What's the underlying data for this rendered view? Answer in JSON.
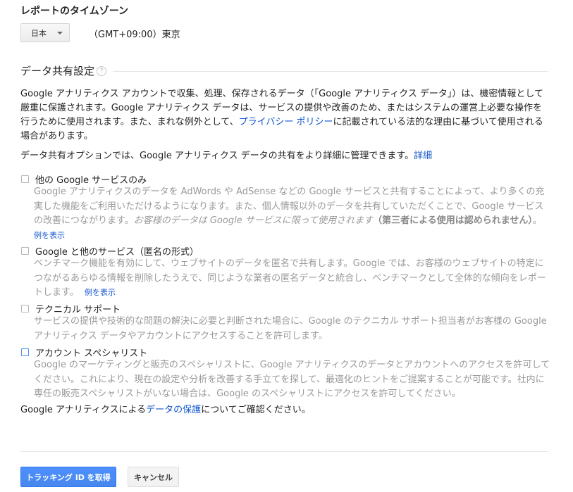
{
  "timezone": {
    "title": "レポートのタイムゾーン",
    "country": "日本",
    "value": "（GMT+09:00）東京"
  },
  "data_sharing": {
    "title": "データ共有設定",
    "help": "?",
    "intro": {
      "part1": "Google アナリティクス アカウントで収集、処理、保存されるデータ（「Google アナリティクス データ」）は、機密情報として厳重に保護されます。Google アナリティクス データは、サービスの提供や改善のため、またはシステムの運営上必要な操作を行うために使用されます。また、まれな例外として、",
      "link": "プライバシー ポリシー",
      "part2": "に記載されている法的な理由に基づいて使用される場合があります。"
    },
    "options_intro": {
      "text": "データ共有オプションでは、Google アナリティクス データの共有をより詳細に管理できます。",
      "link": "詳細"
    },
    "options": [
      {
        "title": "他の Google サービスのみ",
        "desc": "Google アナリティクスのデータを AdWords や AdSense などの Google サービスと共有することによって、より多くの充実した機能をご利用いただけるようになります。また、個人情報以外のデータを共有していただくことで、Google サービスの改善につながります。",
        "desc_italic": "お客様のデータは Google サービスに限って使用されます",
        "desc_bold": "（第三者による使用は認められません）",
        "desc_end": "。",
        "example_link": "例を表示"
      },
      {
        "title": "Google と他のサービス（匿名の形式）",
        "desc": "ベンチマーク機能を有効にして、ウェブサイトのデータを匿名で共有します。Google では、お客様のウェブサイトの特定につながるあらゆる情報を削除したうえで、同じような業者の匿名データと統合し、ベンチマークとして全体的な傾向をレポートします。",
        "example_link": "例を表示"
      },
      {
        "title": "テクニカル サポート",
        "desc": "サービスの提供や技術的な問題の解決に必要と判断された場合に、Google のテクニカル サポート担当者がお客様の Google アナリティクス データやアカウントにアクセスすることを許可します。"
      },
      {
        "title": "アカウント スペシャリスト",
        "desc": "Google のマーケティングと販売のスペシャリストに、Google アナリティクスのデータとアカウントへのアクセスを許可してください。これにより、現在の設定や分析を改善する手立てを探して、最適化のヒントをご提案することが可能です。社内に専任の販売スペシャリストがいない場合は、Google のスペシャリストにアクセスを許可してください。"
      }
    ],
    "footer": {
      "pre": "Google アナリティクスによる",
      "link": "データの保護",
      "post": "についてご確認ください。"
    }
  },
  "buttons": {
    "primary": "トラッキング ID を取得",
    "cancel": "キャンセル"
  },
  "colors": {
    "primary_button": "#4d90fe",
    "link": "#1155cc",
    "muted_text": "#9a9a9a"
  }
}
